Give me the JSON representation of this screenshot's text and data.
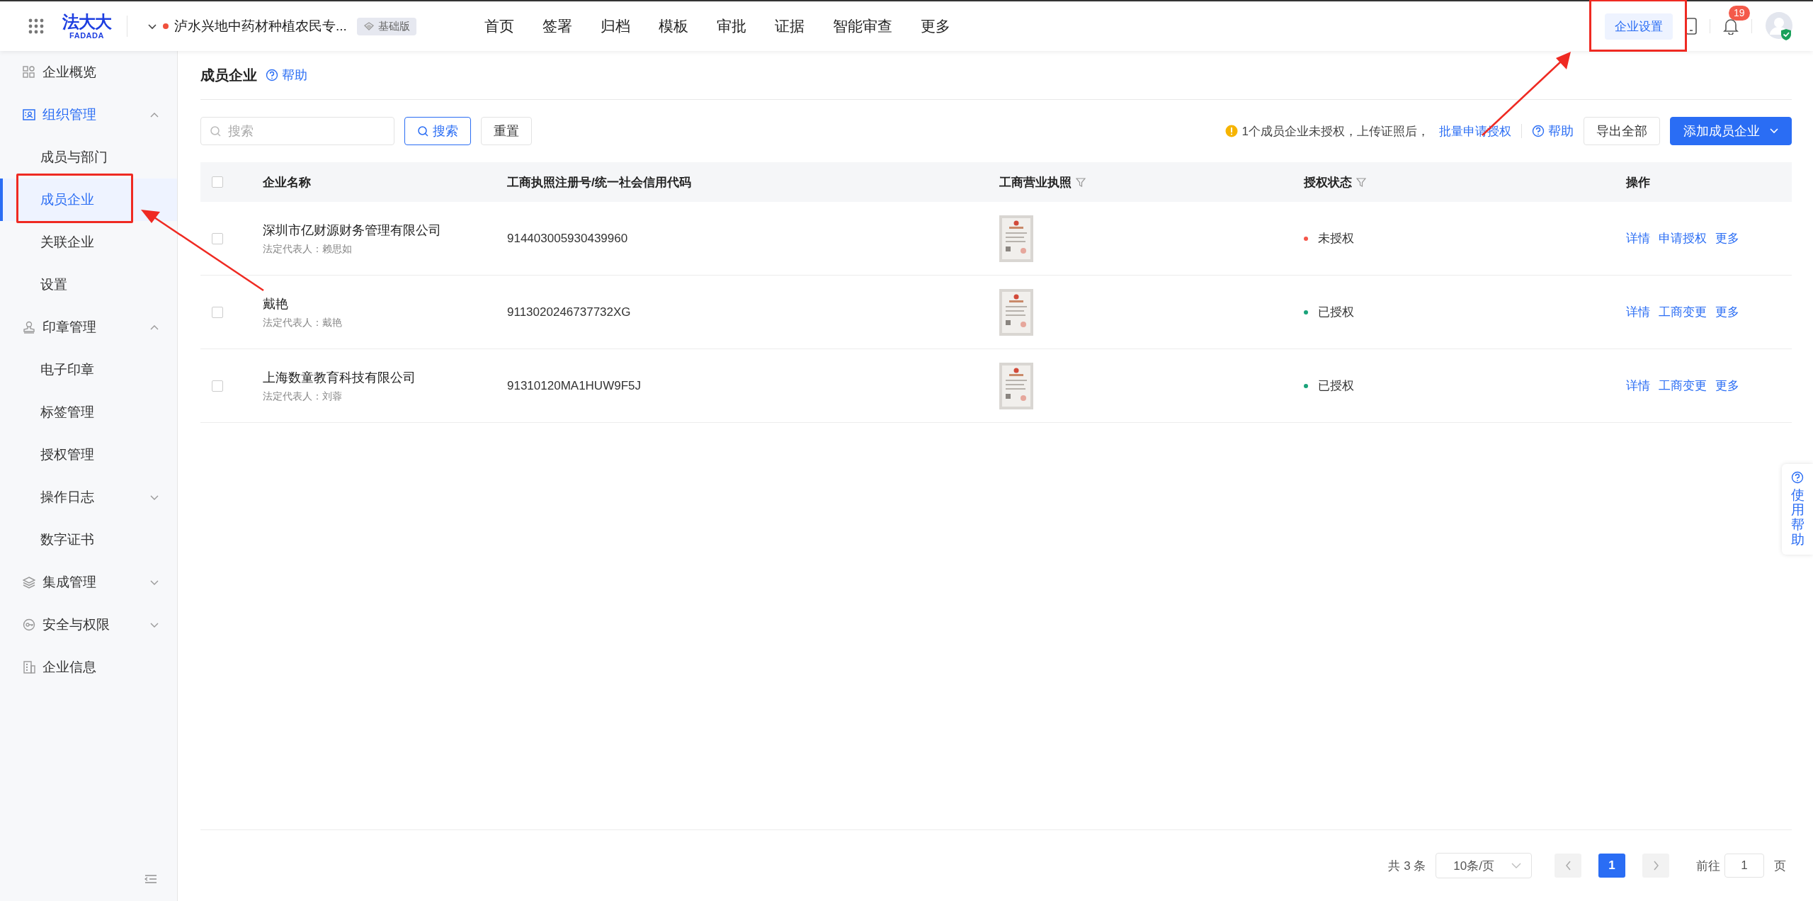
{
  "topbar": {
    "logo": {
      "name": "法大大",
      "sub": "FADADA"
    },
    "company": "泸水兴地中药材种植农民专...",
    "edition": "基础版",
    "nav": [
      {
        "label": "首页"
      },
      {
        "label": "签署"
      },
      {
        "label": "归档"
      },
      {
        "label": "模板"
      },
      {
        "label": "审批"
      },
      {
        "label": "证据"
      },
      {
        "label": "智能审查"
      },
      {
        "label": "更多"
      }
    ],
    "settings_button": {
      "label": "企业设置",
      "highlighted": true
    },
    "notifications": "19"
  },
  "sidebar": {
    "items": [
      {
        "label": "企业概览"
      },
      {
        "label": "组织管理",
        "expanded": true,
        "children": [
          {
            "label": "成员与部门",
            "selected": false,
            "highlighted": false
          },
          {
            "label": "成员企业",
            "selected": true,
            "highlighted": true
          },
          {
            "label": "关联企业",
            "selected": false,
            "highlighted": false
          },
          {
            "label": "设置",
            "selected": false,
            "highlighted": false
          }
        ]
      },
      {
        "label": "印章管理",
        "expanded": true,
        "children": [
          {
            "label": "电子印章",
            "selected": false,
            "highlighted": false
          },
          {
            "label": "标签管理",
            "selected": false,
            "highlighted": false
          },
          {
            "label": "授权管理",
            "selected": false,
            "highlighted": false
          },
          {
            "label": "操作日志",
            "selected": false,
            "highlighted": false,
            "expanded": false
          },
          {
            "label": "数字证书",
            "selected": false,
            "highlighted": false
          }
        ]
      },
      {
        "label": "集成管理",
        "expanded": false
      },
      {
        "label": "安全与权限",
        "expanded": false
      },
      {
        "label": "企业信息"
      }
    ]
  },
  "page": {
    "title": "成员企业",
    "help": "帮助",
    "search": {
      "placeholder": "搜索"
    },
    "search_button": "搜索",
    "reset_button": "重置",
    "notice": "1个成员企业未授权，上传证照后，",
    "notice_link": "批量申请授权",
    "help_link": "帮助",
    "export_button": "导出全部",
    "add_button": "添加成员企业"
  },
  "table": {
    "select_all": {
      "checked": false
    },
    "columns": [
      {
        "label": "企业名称",
        "filter": false
      },
      {
        "label": "工商执照注册号/统一社会信用代码",
        "filter": false
      },
      {
        "label": "工商营业执照",
        "filter": true
      },
      {
        "label": "授权状态",
        "filter": true
      },
      {
        "label": "操作",
        "filter": false
      }
    ],
    "rows": [
      {
        "checked": false,
        "name": "深圳市亿财源财务管理有限公司",
        "legal_rep": "法定代表人：赖思如",
        "code": "914403005930439960",
        "license": {
          "kind": "picture"
        },
        "status": {
          "label": "未授权",
          "color": "#f5564a"
        },
        "actions": [
          "详情",
          "申请授权",
          "更多"
        ]
      },
      {
        "checked": false,
        "name": "戴艳",
        "legal_rep": "法定代表人：戴艳",
        "code": "9113020246737732XG",
        "license": {
          "kind": "picture"
        },
        "status": {
          "label": "已授权",
          "color": "#1aa37a"
        },
        "actions": [
          "详情",
          "工商变更",
          "更多"
        ]
      },
      {
        "checked": false,
        "name": "上海数童教育科技有限公司",
        "legal_rep": "法定代表人：刘蓉",
        "code": "91310120MA1HUW9F5J",
        "license": {
          "kind": "picture"
        },
        "status": {
          "label": "已授权",
          "color": "#1aa37a"
        },
        "actions": [
          "详情",
          "工商变更",
          "更多"
        ]
      }
    ]
  },
  "pagination": {
    "total": "共 3 条",
    "page_size": "10条/页",
    "pages": [
      {
        "label": "1",
        "selected": true
      }
    ],
    "goto_label": "前往",
    "goto_value": "1",
    "goto_unit": "页"
  },
  "help_tab": {
    "label": "使用帮助"
  }
}
